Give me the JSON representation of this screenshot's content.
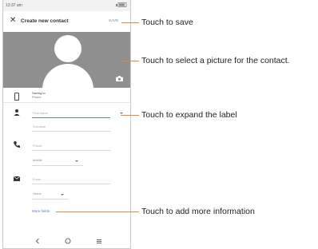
{
  "statusbar": {
    "time": "13:37 am"
  },
  "appbar": {
    "close_icon": "close-icon",
    "title": "Create new contact",
    "save_label": "SAVE"
  },
  "photo": {
    "camera_icon": "camera-icon"
  },
  "account": {
    "saving_to": "Saving to",
    "account_name": "Phone"
  },
  "form": {
    "first_name_placeholder": "First name",
    "surname_placeholder": "Surname",
    "phone_placeholder": "Phone",
    "phone_label": "Mobile",
    "email_placeholder": "Email",
    "email_label": "Home",
    "more_fields": "More fields"
  },
  "callouts": {
    "save": "Touch to save",
    "picture": "Touch to select a picture for the contact.",
    "expand": "Touch to expand the label",
    "more": "Touch to add more information"
  },
  "colors": {
    "accent": "#5b7fc9",
    "callout_line": "#e08a3a",
    "photo_bg": "#8f8f8f"
  }
}
